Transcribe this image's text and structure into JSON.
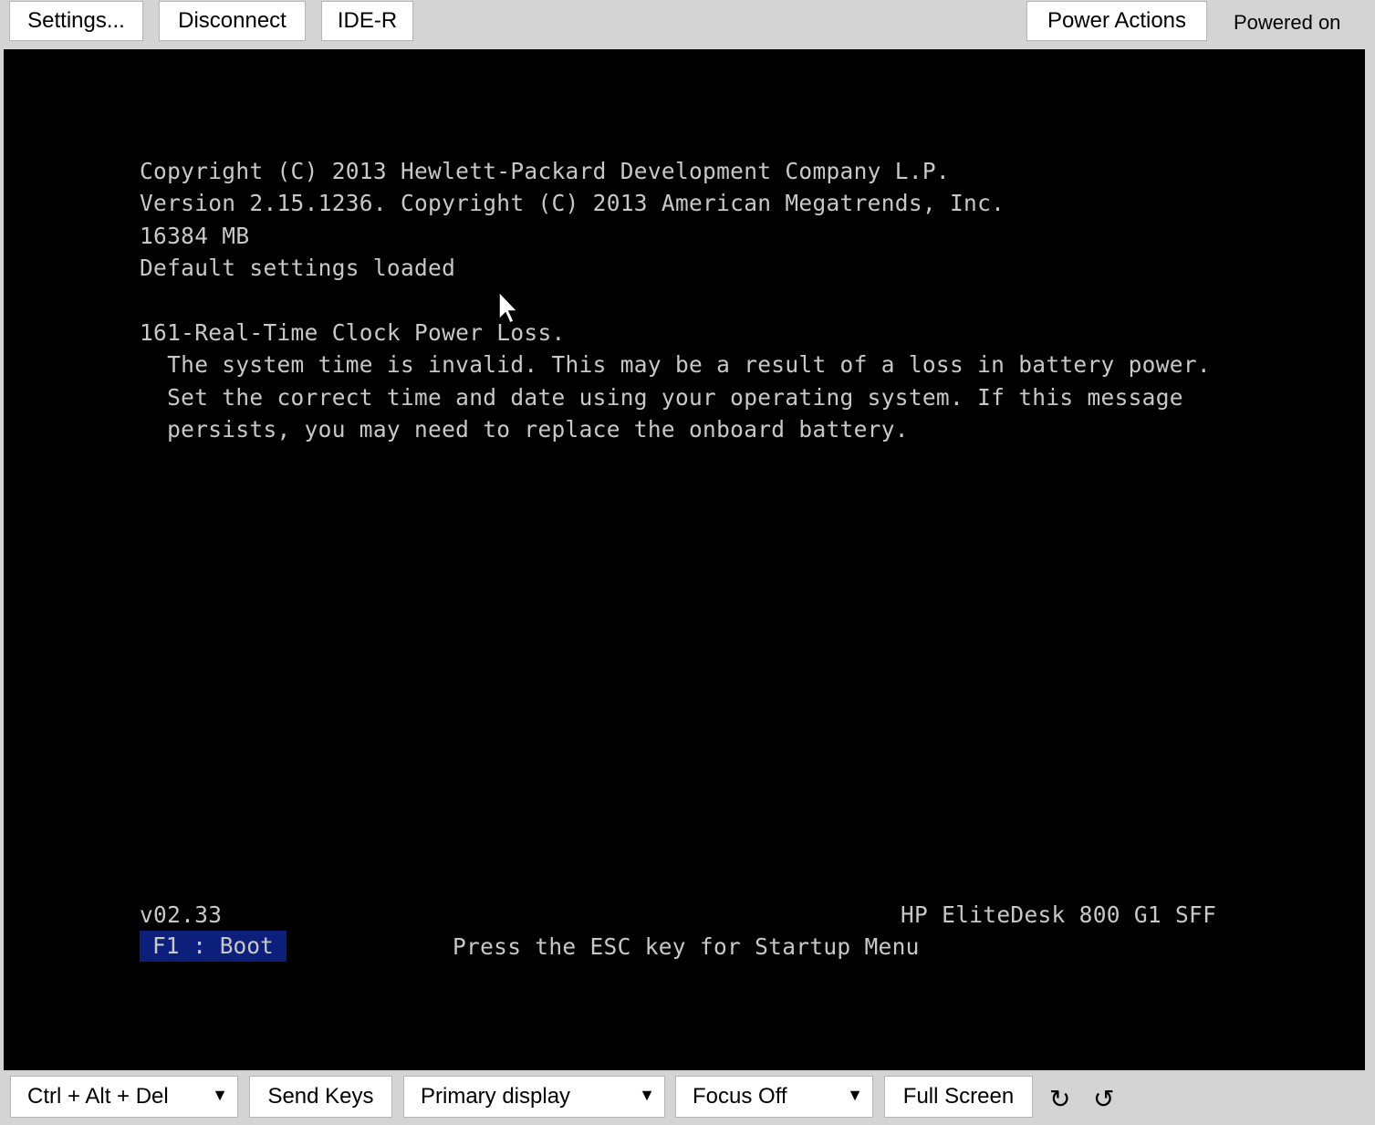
{
  "toolbar": {
    "settings": "Settings...",
    "disconnect": "Disconnect",
    "ide_r": "IDE-R",
    "power_actions": "Power Actions",
    "power_status": "Powered on"
  },
  "console": {
    "lines": [
      "Copyright (C) 2013 Hewlett-Packard Development Company L.P.",
      "Version 2.15.1236. Copyright (C) 2013 American Megatrends, Inc.",
      "16384 MB",
      "Default settings loaded",
      "161-Real-Time Clock Power Loss.",
      "  The system time is invalid. This may be a result of a loss in battery power.",
      "  Set the correct time and date using your operating system. If this message",
      "  persists, you may need to replace the onboard battery."
    ],
    "bios_version": "v02.33",
    "model": "HP EliteDesk 800 G1 SFF",
    "f1_boot": "F1 : Boot",
    "esc_hint": "Press the ESC key for Startup Menu"
  },
  "bottom": {
    "key_combo": "Ctrl + Alt + Del",
    "send_keys": "Send Keys",
    "display": "Primary display",
    "focus": "Focus Off",
    "full_screen": "Full Screen",
    "rotate_cw": "↻",
    "rotate_ccw": "↺",
    "dropdown_arrow": "▼"
  },
  "colors": {
    "screen_bg": "#000000",
    "console_text": "#c8c8c8",
    "f1_highlight": "#0c1f7a",
    "chrome_bg": "#d4d4d4"
  }
}
